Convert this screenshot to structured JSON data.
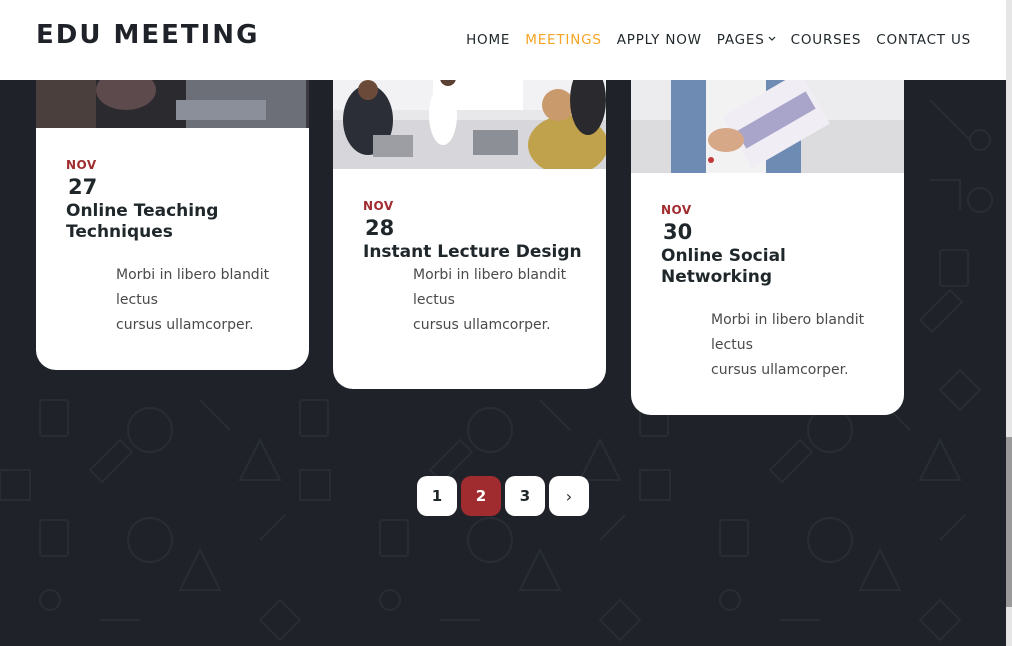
{
  "header": {
    "logo": "EDU MEETING",
    "nav": [
      {
        "label": "HOME",
        "active": false
      },
      {
        "label": "MEETINGS",
        "active": true
      },
      {
        "label": "APPLY NOW",
        "active": false
      },
      {
        "label": "PAGES",
        "active": false,
        "dropdown": true
      },
      {
        "label": "COURSES",
        "active": false
      },
      {
        "label": "CONTACT US",
        "active": false
      }
    ],
    "dropdown_icon": "chevron-down-icon"
  },
  "cards": [
    {
      "month": "NOV",
      "day": "27",
      "title_line1": "Online Teaching",
      "title_line2": "Techniques",
      "desc_line1": "Morbi in libero blandit",
      "desc_line2": "lectus",
      "desc_line3": "cursus ullamcorper."
    },
    {
      "month": "NOV",
      "day": "28",
      "title_line1": "Instant Lecture Design",
      "title_line2": "",
      "desc_line1": "Morbi in libero blandit",
      "desc_line2": "lectus",
      "desc_line3": "cursus ullamcorper."
    },
    {
      "month": "NOV",
      "day": "30",
      "title_line1": "Online Social",
      "title_line2": "Networking",
      "desc_line1": "Morbi in libero blandit",
      "desc_line2": "lectus",
      "desc_line3": "cursus ullamcorper."
    }
  ],
  "pagination": {
    "pages": [
      "1",
      "2",
      "3"
    ],
    "current": "2",
    "next_icon": "chevron-right-icon",
    "next_label": "›"
  },
  "colors": {
    "accent": "#f5a425",
    "brand_red": "#a12c2f",
    "background": "#1f2329",
    "text_dark": "#1f272b"
  }
}
